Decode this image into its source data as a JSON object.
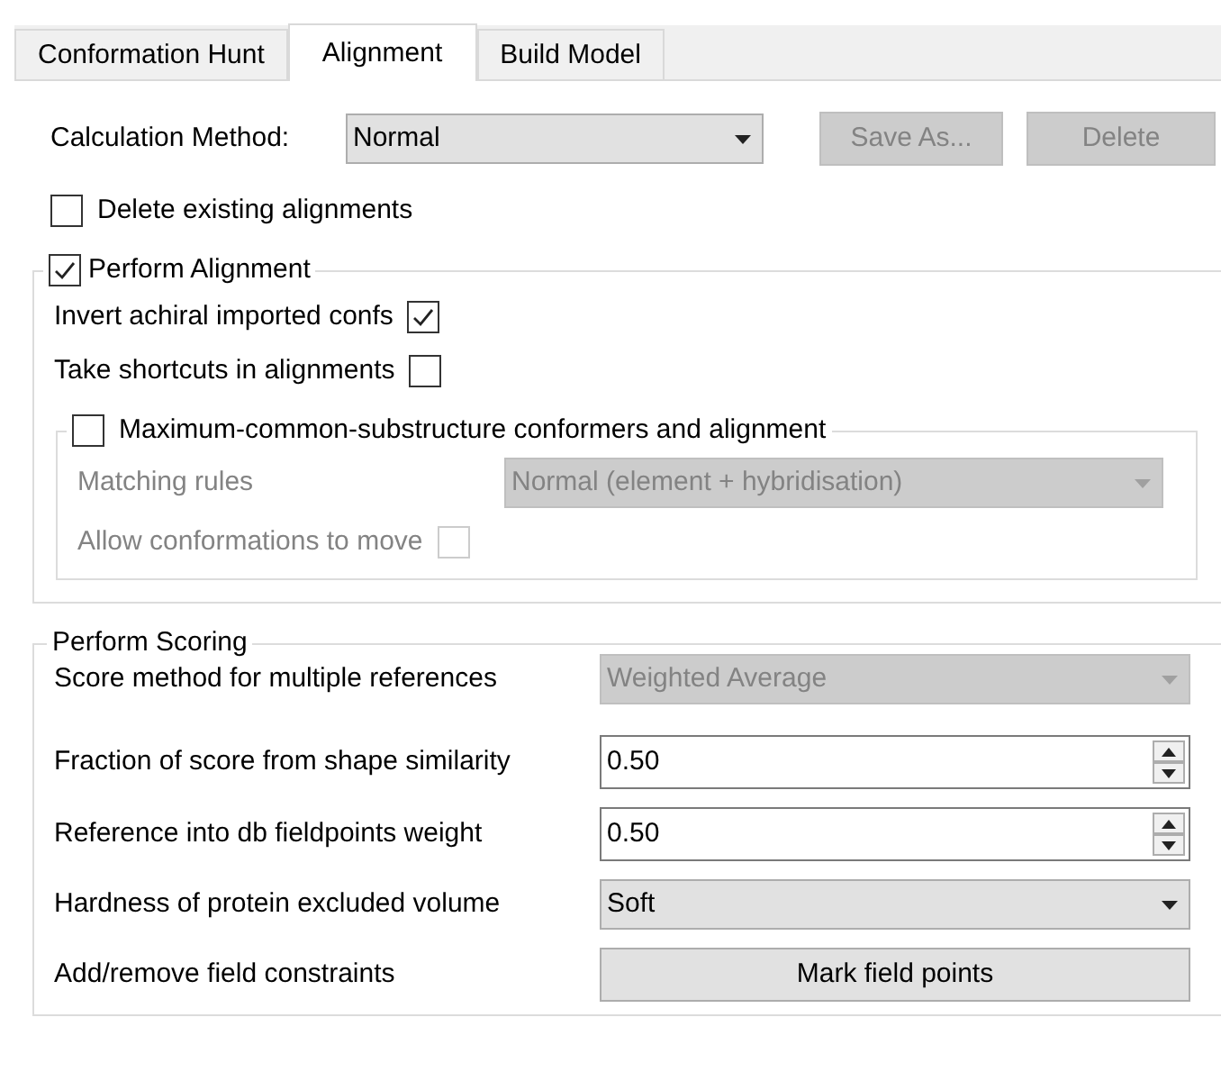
{
  "tabs": [
    {
      "label": "Conformation Hunt",
      "selected": false
    },
    {
      "label": "Alignment",
      "selected": true
    },
    {
      "label": "Build Model",
      "selected": false
    }
  ],
  "calculation_method": {
    "label": "Calculation Method:",
    "value": "Normal"
  },
  "buttons": [
    {
      "label": "Save As...",
      "disabled": true
    },
    {
      "label": "Delete",
      "disabled": true
    }
  ],
  "delete_existing": {
    "label": "Delete existing alignments",
    "checked": false
  },
  "perform_alignment": {
    "label": "Perform Alignment",
    "checked": true,
    "options": [
      {
        "label": "Invert achiral imported confs",
        "checked": true,
        "disabled": false
      },
      {
        "label": "Take shortcuts in alignments",
        "checked": false,
        "disabled": false
      }
    ],
    "mcs": {
      "label": "Maximum-common-substructure conformers and alignment",
      "checked": false,
      "matching_rules": {
        "label": "Matching rules",
        "value": "Normal (element + hybridisation)",
        "disabled": true
      },
      "allow_move": {
        "label": "Allow conformations to move",
        "checked": false,
        "disabled": true
      }
    }
  },
  "perform_scoring": {
    "title": "Perform Scoring",
    "rows": [
      {
        "kind": "select",
        "label": "Score method for multiple references",
        "value": "Weighted Average",
        "disabled": true
      },
      {
        "kind": "spin",
        "label": "Fraction of score from shape similarity",
        "value": "0.50",
        "disabled": false
      },
      {
        "kind": "spin",
        "label": "Reference into db fieldpoints weight",
        "value": "0.50",
        "disabled": false
      },
      {
        "kind": "select",
        "label": "Hardness of protein excluded volume",
        "value": "Soft",
        "disabled": false
      },
      {
        "kind": "button",
        "label": "Add/remove field constraints",
        "value": "Mark field points",
        "disabled": false
      }
    ]
  }
}
